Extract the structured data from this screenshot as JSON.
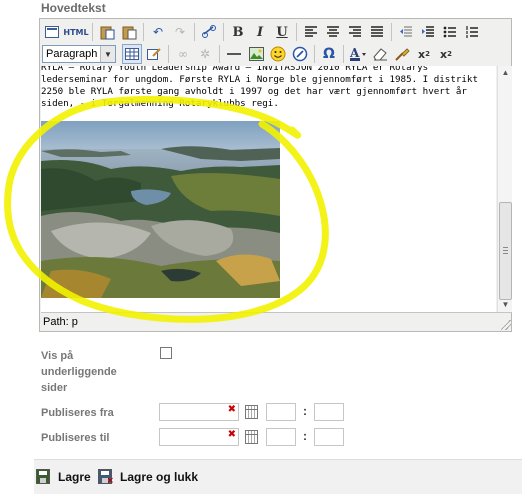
{
  "editor": {
    "field_label": "Hovedtekst",
    "format_select": "Paragraph",
    "path_label": "Path: p",
    "content_lines": [
      "RYLA – Rotary Youth Leadership Award – INVITASJON 2010 RYLA er Rotarys",
      "lederseminar for ungdom. Første RYLA i Norge ble gjennomført i 1985. I distrikt",
      "2250 ble RYLA første gang avholdt i 1997 og det har vært gjennomført hvert år",
      "siden, - i Torgalmenning Rotaryklubbs regi."
    ],
    "toolbar_icons": [
      "source-icon",
      "html-icon",
      "paste-word-icon",
      "paste-text-icon",
      "undo-icon",
      "redo-icon",
      "link-icon",
      "bold-icon",
      "italic-icon",
      "underline-icon",
      "align-left-icon",
      "align-center-icon",
      "align-right-icon",
      "justify-icon",
      "outdent-icon",
      "indent-icon",
      "bullet-list-icon",
      "numbered-list-icon",
      "table-icon",
      "edit-icon",
      "link-disabled-icon",
      "unlink-icon",
      "horizontal-rule-icon",
      "image-icon",
      "emoticon-icon",
      "spellcheck-icon",
      "special-char-icon",
      "text-color-icon",
      "eraser-icon",
      "cleanup-icon",
      "subscript-icon",
      "superscript-icon"
    ]
  },
  "form": {
    "visible_label": "Vis på underliggende sider",
    "publish_from_label": "Publiseres fra",
    "publish_to_label": "Publiseres til",
    "visible_checked": false
  },
  "actions": {
    "save_label": "Lagre",
    "save_close_label": "Lagre og lukk"
  },
  "colors": {
    "highlight": "#f2f200",
    "clear_x": "#cc0000"
  }
}
